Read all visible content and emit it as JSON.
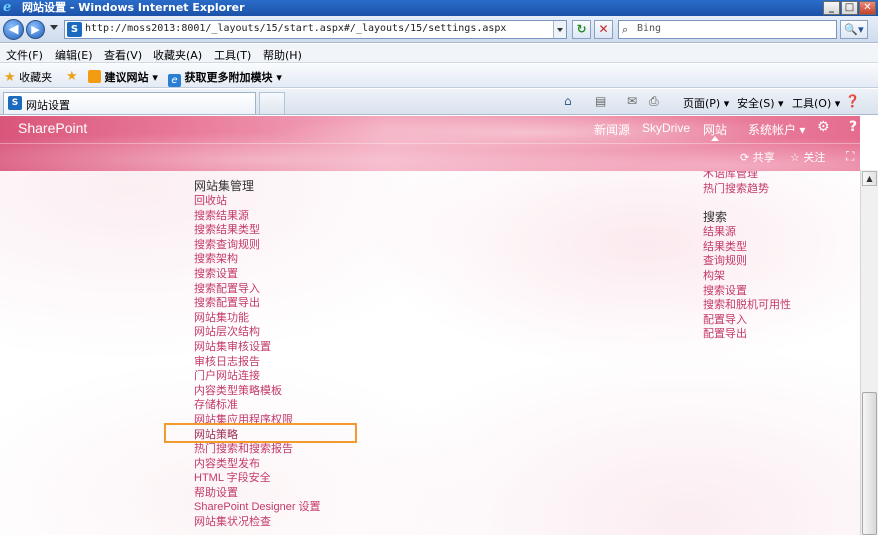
{
  "window": {
    "title": "网站设置 - Windows Internet Explorer",
    "controls": [
      "_",
      "□",
      "✕"
    ]
  },
  "addressbar": {
    "url": "http://moss2013:8001/_layouts/15/start.aspx#/_layouts/15/settings.aspx",
    "search_placeholder": "Bing",
    "search_button": "🔍▾",
    "back": "◀",
    "forward": "▶",
    "refresh": "↻",
    "stop": "✕"
  },
  "menubar": [
    "文件(F)",
    "编辑(E)",
    "查看(V)",
    "收藏夹(A)",
    "工具(T)",
    "帮助(H)"
  ],
  "favorites": {
    "label": "收藏夹",
    "items": [
      "建议网站 ▾",
      "获取更多附加模块 ▾"
    ]
  },
  "tab": {
    "title": "网站设置"
  },
  "commandbar": {
    "items": [
      "页面(P) ▾",
      "安全(S) ▾",
      "工具(O) ▾"
    ]
  },
  "sharepoint": {
    "brand": "SharePoint",
    "nav": [
      "新闻源",
      "SkyDrive",
      "网站"
    ],
    "account": "系统帐户 ▾",
    "share": "共享",
    "follow": "关注"
  },
  "site_collection_admin": {
    "heading": "网站集管理",
    "links": [
      "回收站",
      "搜索结果源",
      "搜索结果类型",
      "搜索查询规则",
      "搜索架构",
      "搜索设置",
      "搜索配置导入",
      "搜索配置导出",
      "网站集功能",
      "网站层次结构",
      "网站集审核设置",
      "审核日志报告",
      "门户网站连接",
      "内容类型策略模板",
      "存储标准",
      "网站集应用程序权限",
      "网站策略",
      "热门搜索和搜索报告",
      "内容类型发布",
      "HTML 字段安全",
      "帮助设置",
      "SharePoint Designer 设置",
      "网站集状况检查"
    ],
    "highlighted": "网站策略"
  },
  "right_column": {
    "top_links": [
      "术语库管理",
      "热门搜索趋势"
    ],
    "search_heading": "搜索",
    "search_links": [
      "结果源",
      "结果类型",
      "查询规则",
      "构架",
      "搜索设置",
      "搜索和脱机可用性",
      "配置导入",
      "配置导出"
    ]
  }
}
